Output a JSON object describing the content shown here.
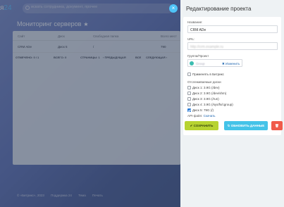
{
  "background": {
    "logo_text": "я",
    "logo_num": "24",
    "search_placeholder": "искать сотрудника, документ, прочее",
    "page_title": "Мониторинг серверов",
    "table": {
      "headers": [
        "Сайт",
        "Диск",
        "Свободная папка",
        "Всего мест"
      ],
      "row": [
        "CRM ADe",
        "Диск 5",
        "/",
        "790"
      ]
    },
    "pager": {
      "selected": "ОТМЕЧЕНО: 0 / 1",
      "total": "ВСЕГО: 0",
      "pages": "СТРАНИЦЫ: 1",
      "prev": "‹ ПРЕДЫДУЩАЯ",
      "all": "ВСЕ",
      "next": "СЛЕДУЮЩАЯ ›"
    },
    "footer": [
      "© «Битрикс», 2023",
      "Поддержка 24",
      "Тема",
      "Печать"
    ],
    "close": "×"
  },
  "panel": {
    "title": "Редактирование проекта",
    "name_label": "Название:",
    "name_value": "CRM ADe",
    "url_label": "URL:",
    "url_value": "http://crm.example.ru",
    "group_label": "Группа/Проект",
    "group_name": "Group",
    "group_change": "✖ Изменить",
    "notify_label": "Применять в Битрикс",
    "disks_label": "Отслеживаемые диски",
    "disks": [
      {
        "label": "Диск 1: 3.9G (/dev)",
        "checked": false
      },
      {
        "label": "Диск 2: 3.9G (/dev/shm)",
        "checked": false
      },
      {
        "label": "Диск 3: 3.9G (/run)",
        "checked": false
      },
      {
        "label": "Диск 4: 3.9G (/sys/fs/cgroup)",
        "checked": false
      },
      {
        "label": "Диск 5: 79G (/)",
        "checked": true
      }
    ],
    "api_label": "API-файл:",
    "api_link": "Скачать",
    "save_btn": "✔ СОХРАНИТЬ",
    "update_btn": "↻ ОБНОВИТЬ ДАННЫЕ",
    "delete_btn": "🗑",
    "colors": {
      "save": "#b7d331",
      "update": "#44c3e8",
      "delete": "#f05a4a",
      "link": "#2067b0"
    }
  }
}
